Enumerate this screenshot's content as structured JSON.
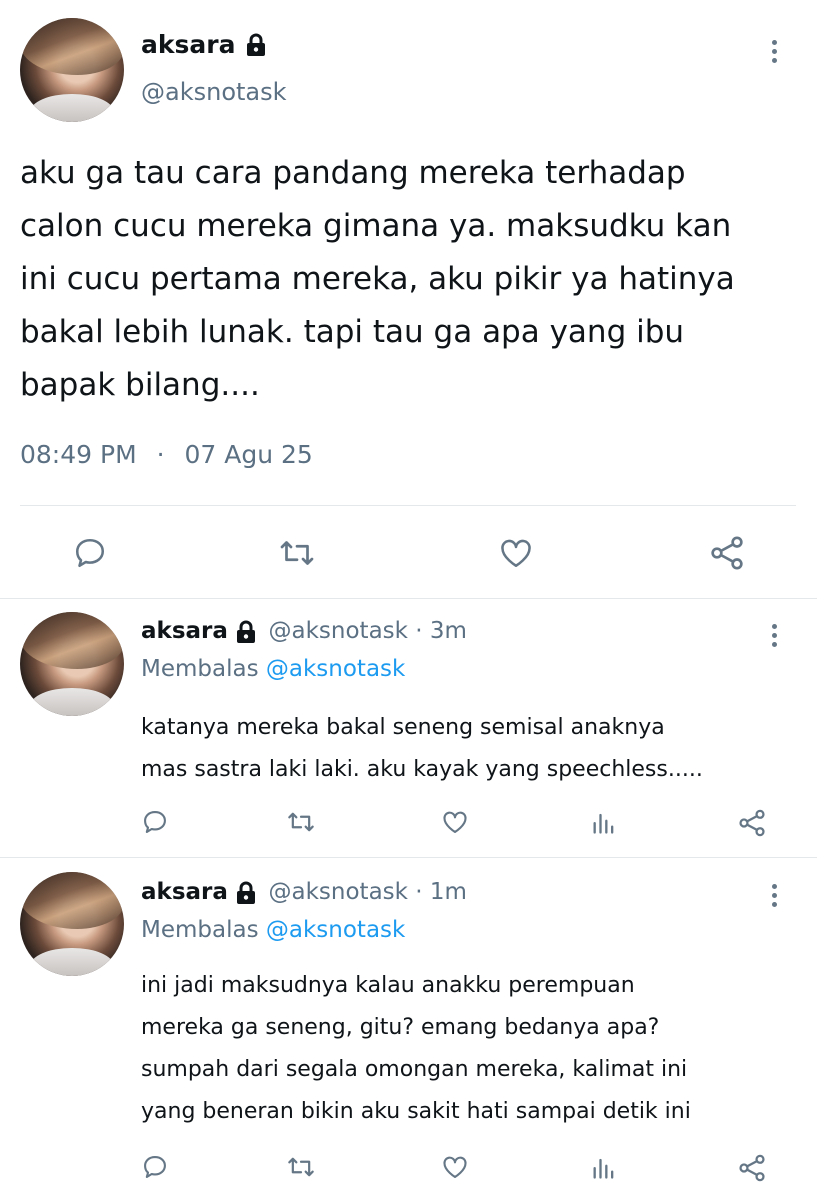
{
  "main_tweet": {
    "author_name": "aksara",
    "author_handle": "@aksnotask",
    "text_lines": [
      "aku ga tau cara pandang mereka terhadap",
      "calon cucu mereka gimana ya. maksudku kan",
      "ini cucu pertama mereka, aku pikir ya hatinya",
      "bakal lebih lunak. tapi tau ga apa yang ibu",
      "bapak bilang...."
    ],
    "time": "08:49 PM",
    "separator": "·",
    "date": "07 Agu 25"
  },
  "replies": [
    {
      "author_name": "aksara",
      "author_handle": "@aksnotask",
      "age": "3m",
      "replying_prefix": "Membalas",
      "replying_to": "@aksnotask",
      "text_lines": [
        "katanya mereka bakal seneng semisal anaknya",
        "mas sastra laki laki. aku kayak yang speechless....."
      ]
    },
    {
      "author_name": "aksara",
      "author_handle": "@aksnotask",
      "age": "1m",
      "replying_prefix": "Membalas",
      "replying_to": "@aksnotask",
      "text_lines": [
        "ini jadi maksudnya kalau anakku perempuan",
        "mereka ga seneng, gitu? emang bedanya apa?",
        "sumpah dari segala omongan mereka, kalimat ini",
        "yang beneran bikin aku sakit hati sampai detik ini"
      ]
    }
  ],
  "icons": {
    "lock": "lock-icon",
    "more": "more-vertical-icon",
    "reply": "reply-icon",
    "retweet": "retweet-icon",
    "like": "heart-icon",
    "analytics": "analytics-icon",
    "share": "share-icon"
  },
  "colors": {
    "text": "#0f1419",
    "muted": "#5b7083",
    "link": "#1d9bf0",
    "divider": "#e4e8eb",
    "icon": "#657786"
  }
}
